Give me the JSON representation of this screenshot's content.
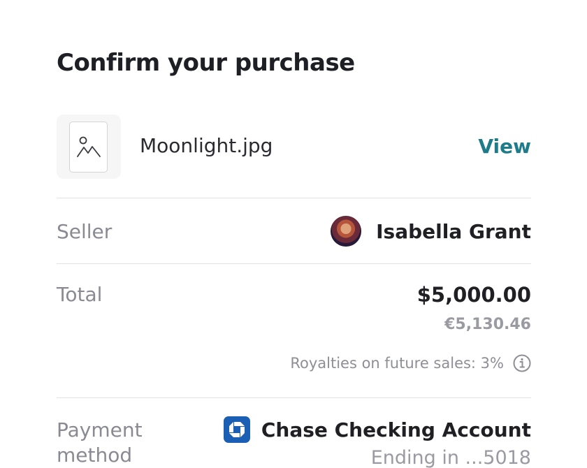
{
  "title": "Confirm your purchase",
  "file": {
    "name": "Moonlight.jpg",
    "view_label": "View",
    "thumbnail_icon": "image-icon"
  },
  "seller": {
    "label": "Seller",
    "name": "Isabella Grant"
  },
  "total": {
    "label": "Total",
    "amount": "$5,000.00",
    "converted": "€5,130.46",
    "royalties": "Royalties on future sales: 3%",
    "info_icon": "info-icon"
  },
  "payment": {
    "label_line1": "Payment",
    "label_line2": "method",
    "account_name": "Chase Checking Account",
    "account_ending": "Ending in ...5018",
    "bank_icon": "chase-logo-icon"
  },
  "colors": {
    "accent": "#1e7b8a",
    "bank": "#1a5fb4"
  }
}
